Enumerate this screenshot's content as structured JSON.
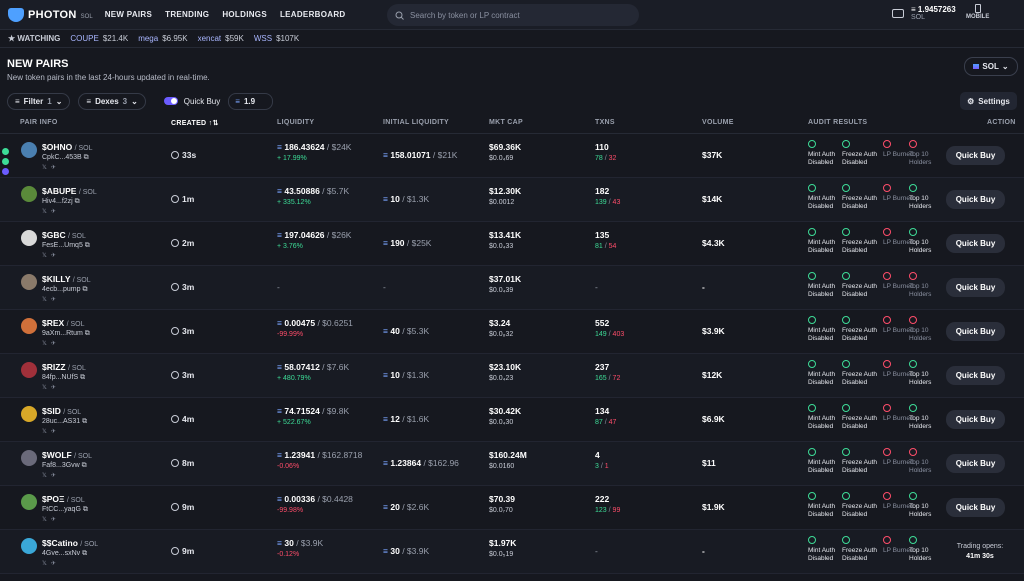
{
  "app": {
    "name": "PHOTON",
    "sub": "SOL"
  },
  "nav": [
    "NEW PAIRS",
    "TRENDING",
    "HOLDINGS",
    "LEADERBOARD"
  ],
  "search": {
    "placeholder": "Search by token or LP contract"
  },
  "wallet": {
    "balance": "1.9457263",
    "currency": "SOL"
  },
  "mobile_label": "MOBILE",
  "watching": {
    "label": "WATCHING",
    "items": [
      {
        "symbol": "COUPE",
        "value": "$21.4K"
      },
      {
        "symbol": "mega",
        "value": "$6.95K"
      },
      {
        "symbol": "xencat",
        "value": "$59K"
      },
      {
        "symbol": "WSS",
        "value": "$107K"
      }
    ]
  },
  "page": {
    "title": "NEW PAIRS",
    "subtitle": "New token pairs in the last 24-hours updated in real-time."
  },
  "chain_select": "SOL",
  "filters": {
    "filter_label": "Filter",
    "filter_count": "1",
    "dexes_label": "Dexes",
    "dexes_count": "3",
    "quick_buy_label": "Quick Buy",
    "quick_buy_amount": "1.9",
    "settings_label": "Settings"
  },
  "columns": [
    "PAIR INFO",
    "CREATED",
    "LIQUIDITY",
    "INITIAL LIQUIDITY",
    "MKT CAP",
    "TXNS",
    "VOLUME",
    "AUDIT RESULTS",
    "ACTION"
  ],
  "rows": [
    {
      "name": "$OHNO",
      "chain": "/ SOL",
      "addr": "CpkC...453B",
      "age": "33s",
      "liq": "186.43624",
      "liq_usd": "/ $24K",
      "liq_chg": "+ 17.99%",
      "liq_dir": "pos",
      "init": "158.01071",
      "init_usd": "/ $21K",
      "mcap": "$69.36K",
      "mcap_sub": "$0.0₄69",
      "txns": "110",
      "buys": "78",
      "sells": "32",
      "vol": "$37K",
      "audit": [
        true,
        true,
        false,
        false
      ],
      "action": "Quick Buy",
      "color": "#4a7fb0"
    },
    {
      "name": "$ABUPE",
      "chain": "/ SOL",
      "addr": "Hiv4...f2zj",
      "age": "1m",
      "liq": "43.50886",
      "liq_usd": "/ $5.7K",
      "liq_chg": "+ 335.12%",
      "liq_dir": "pos",
      "init": "10",
      "init_usd": "/ $1.3K",
      "mcap": "$12.30K",
      "mcap_sub": "$0.0012",
      "txns": "182",
      "buys": "139",
      "sells": "43",
      "vol": "$14K",
      "audit": [
        true,
        true,
        false,
        true
      ],
      "action": "Quick Buy",
      "color": "#5a8a3a"
    },
    {
      "name": "$GBC",
      "chain": "/ SOL",
      "addr": "FesE...Umq5",
      "age": "2m",
      "liq": "197.04626",
      "liq_usd": "/ $26K",
      "liq_chg": "+ 3.76%",
      "liq_dir": "pos",
      "init": "190",
      "init_usd": "/ $25K",
      "mcap": "$13.41K",
      "mcap_sub": "$0.0₄33",
      "txns": "135",
      "buys": "81",
      "sells": "54",
      "vol": "$4.3K",
      "audit": [
        true,
        true,
        false,
        true
      ],
      "action": "Quick Buy",
      "color": "#d9d9d9"
    },
    {
      "name": "$KILLY",
      "chain": "/ SOL",
      "addr": "4ecb...pump",
      "age": "3m",
      "liq": "-",
      "liq_usd": "",
      "liq_chg": "",
      "liq_dir": "pos",
      "init": "-",
      "init_usd": "",
      "mcap": "$37.01K",
      "mcap_sub": "$0.0₄39",
      "txns": "-",
      "buys": "",
      "sells": "",
      "vol": "-",
      "audit": [
        true,
        true,
        false,
        false
      ],
      "action": "Quick Buy",
      "color": "#8a7a6a"
    },
    {
      "name": "$REX",
      "chain": "/ SOL",
      "addr": "9aXm...Rtum",
      "age": "3m",
      "liq": "0.00475",
      "liq_usd": "/ $0.6251",
      "liq_chg": "-99.99%",
      "liq_dir": "neg",
      "init": "40",
      "init_usd": "/ $5.3K",
      "mcap": "$3.24",
      "mcap_sub": "$0.0₈32",
      "txns": "552",
      "buys": "149",
      "sells": "403",
      "vol": "$3.9K",
      "audit": [
        true,
        true,
        false,
        false
      ],
      "action": "Quick Buy",
      "color": "#d0703a"
    },
    {
      "name": "$RIZZ",
      "chain": "/ SOL",
      "addr": "84fp...NUfS",
      "age": "3m",
      "liq": "58.07412",
      "liq_usd": "/ $7.6K",
      "liq_chg": "+ 480.79%",
      "liq_dir": "pos",
      "init": "10",
      "init_usd": "/ $1.3K",
      "mcap": "$23.10K",
      "mcap_sub": "$0.0₄23",
      "txns": "237",
      "buys": "165",
      "sells": "72",
      "vol": "$12K",
      "audit": [
        true,
        true,
        false,
        true
      ],
      "action": "Quick Buy",
      "color": "#a0303a"
    },
    {
      "name": "$SID",
      "chain": "/ SOL",
      "addr": "28uc...AS31",
      "age": "4m",
      "liq": "74.71524",
      "liq_usd": "/ $9.8K",
      "liq_chg": "+ 522.67%",
      "liq_dir": "pos",
      "init": "12",
      "init_usd": "/ $1.6K",
      "mcap": "$30.42K",
      "mcap_sub": "$0.0₄30",
      "txns": "134",
      "buys": "87",
      "sells": "47",
      "vol": "$6.9K",
      "audit": [
        true,
        true,
        false,
        true
      ],
      "action": "Quick Buy",
      "color": "#d8a828"
    },
    {
      "name": "$WOLF",
      "chain": "/ SOL",
      "addr": "Faf8...3Gvw",
      "age": "8m",
      "liq": "1.23941",
      "liq_usd": "/ $162.8718",
      "liq_chg": "-0.06%",
      "liq_dir": "neg",
      "init": "1.23864",
      "init_usd": "/ $162.96",
      "mcap": "$160.24M",
      "mcap_sub": "$0.0160",
      "txns": "4",
      "buys": "3",
      "sells": "1",
      "vol": "$11",
      "audit": [
        true,
        true,
        false,
        false
      ],
      "action": "Quick Buy",
      "color": "#6a6a7a"
    },
    {
      "name": "$POΞ",
      "chain": "/ SOL",
      "addr": "FtCC...yaqG",
      "age": "9m",
      "liq": "0.00336",
      "liq_usd": "/ $0.4428",
      "liq_chg": "-99.98%",
      "liq_dir": "neg",
      "init": "20",
      "init_usd": "/ $2.6K",
      "mcap": "$70.39",
      "mcap_sub": "$0.0₇70",
      "txns": "222",
      "buys": "123",
      "sells": "99",
      "vol": "$1.9K",
      "audit": [
        true,
        true,
        false,
        true
      ],
      "action": "Quick Buy",
      "color": "#5a9a4a"
    },
    {
      "name": "$$Catino",
      "chain": "/ SOL",
      "addr": "4Gve...sxNv",
      "age": "9m",
      "liq": "30",
      "liq_usd": "/ $3.9K",
      "liq_chg": "-0.12%",
      "liq_dir": "neg",
      "init": "30",
      "init_usd": "/ $3.9K",
      "mcap": "$1.97K",
      "mcap_sub": "$0.0₅19",
      "txns": "-",
      "buys": "",
      "sells": "",
      "vol": "-",
      "audit": [
        true,
        true,
        false,
        true
      ],
      "action": "",
      "trading_label": "Trading opens:",
      "trading_time": "41m 30s",
      "color": "#3aa8d8"
    }
  ],
  "audit_labels": [
    "Mint Auth Disabled",
    "Freeze Auth Disabled",
    "LP Burned",
    "Top 10 Holders"
  ],
  "colors": {
    "accent": "#6b5cff",
    "positive": "#3ddc97",
    "negative": "#ff4d6a",
    "bg": "#16181f"
  }
}
